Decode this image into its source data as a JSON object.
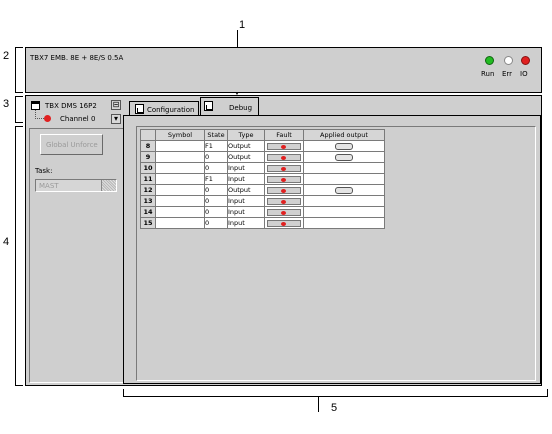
{
  "callouts": [
    "1",
    "2",
    "3",
    "4",
    "5"
  ],
  "module": {
    "title": "TBX7 EMB. 8E + 8E/S 0.5A",
    "leds": [
      {
        "label": "Run",
        "color": "#22bb22"
      },
      {
        "label": "Err",
        "color": "#ffffff"
      },
      {
        "label": "IO",
        "color": "#e02020"
      }
    ]
  },
  "channel_selector": {
    "module_name": "TBX DMS 16P2",
    "channel": "Channel 0"
  },
  "left_panel": {
    "global_unforce": "Global Unforce",
    "task_label": "Task:",
    "task_value": "MAST"
  },
  "tabs": [
    {
      "label": "Configuration"
    },
    {
      "label": "Debug",
      "active": true
    }
  ],
  "table": {
    "headers": [
      "",
      "Symbol",
      "State",
      "Type",
      "Fault",
      "Applied output"
    ],
    "rows": [
      {
        "num": "8",
        "symbol": "",
        "state": "F1",
        "type": "Output",
        "fault": true,
        "applied": true
      },
      {
        "num": "9",
        "symbol": "",
        "state": "0",
        "type": "Output",
        "fault": true,
        "applied": true
      },
      {
        "num": "10",
        "symbol": "",
        "state": "0",
        "type": "Input",
        "fault": true,
        "applied": false
      },
      {
        "num": "11",
        "symbol": "",
        "state": "F1",
        "type": "Input",
        "fault": true,
        "applied": false
      },
      {
        "num": "12",
        "symbol": "",
        "state": "0",
        "type": "Output",
        "fault": true,
        "applied": true
      },
      {
        "num": "13",
        "symbol": "",
        "state": "0",
        "type": "Input",
        "fault": true,
        "applied": false
      },
      {
        "num": "14",
        "symbol": "",
        "state": "0",
        "type": "Input",
        "fault": true,
        "applied": false
      },
      {
        "num": "15",
        "symbol": "",
        "state": "0",
        "type": "Input",
        "fault": true,
        "applied": false
      }
    ]
  }
}
